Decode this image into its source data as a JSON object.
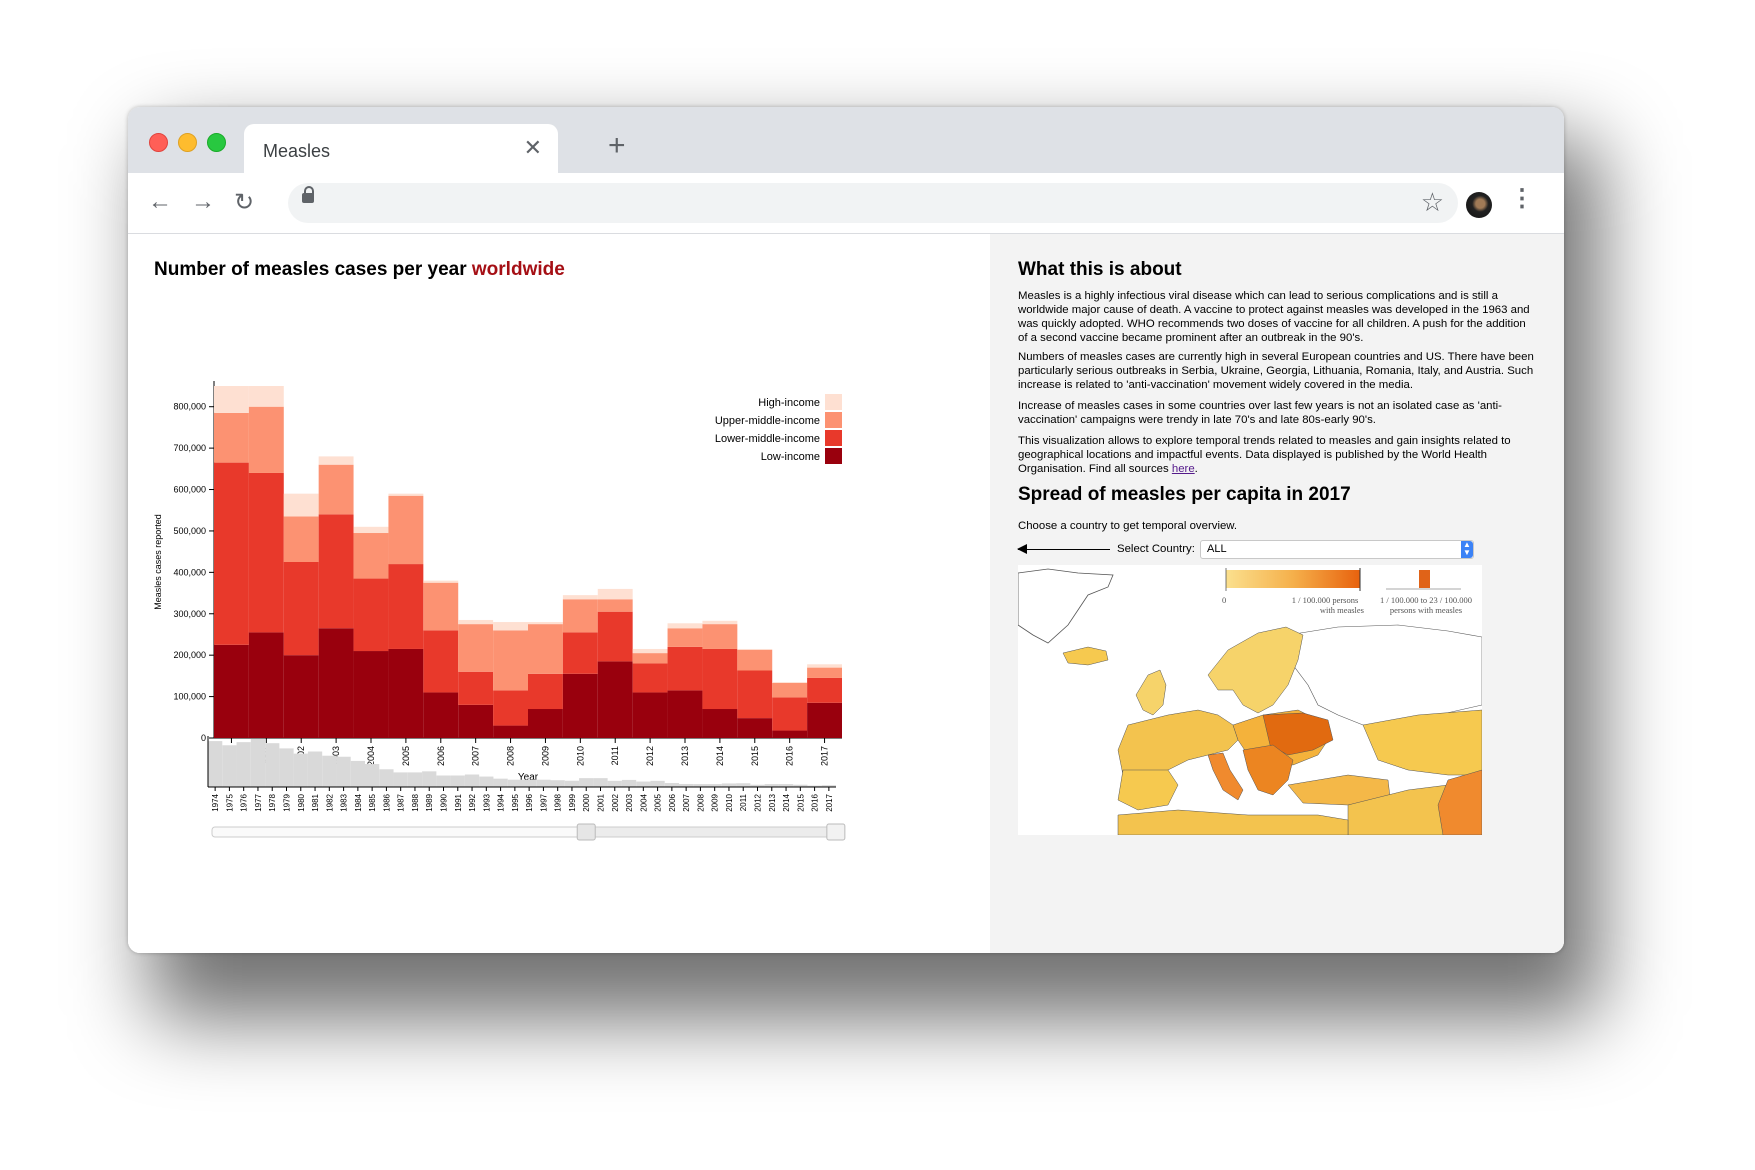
{
  "browser": {
    "tab_title": "Measles",
    "tab_close": "✕",
    "new_tab": "+"
  },
  "left": {
    "title_main": "Number of measles cases per year ",
    "title_highlight": "worldwide",
    "title_highlight_color": "#a50f15"
  },
  "right": {
    "about_title": "What this is about",
    "p1": "Measles is a highly infectious viral disease which can lead to serious complications and is still a worldwide major cause of death. A vaccine to protect against measles was developed in the 1963 and was quickly adopted. WHO recommends two doses of vaccine for all children. A push for the addition of a second vaccine became prominent after an outbreak in the 90's.",
    "p2": "Numbers of measles cases are currently high in several European countries and US. There have been particularly serious outbreaks in Serbia, Ukraine, Georgia, Lithuania, Romania, Italy, and Austria. Such increase is related to 'anti-vaccination' movement widely covered in the media.",
    "p3": "Increase of measles cases in some countries over last few years is not an isolated case as 'anti-vaccination' campaigns were trendy in late 70's and late 80s-early 90's.",
    "p4_text": "This visualization allows to explore temporal trends related to measles and gain insights related to geographical locations and impactful events. Data displayed is published by the World Health Organisation. Find all sources ",
    "p4_link": "here",
    "p4_end": ".",
    "spread_title": "Spread of measles per capita in 2017",
    "choose_text": "Choose a country to get temporal overview.",
    "select_label": "Select Country:",
    "select_value": "ALL",
    "map_legend": {
      "zero": "0",
      "label1_line1": "1 / 100.000 persons",
      "label1_line2": "with measles",
      "label2_line1": "1 / 100.000  to 23 / 100.000",
      "label2_line2": "persons with measles"
    }
  },
  "chart_data": [
    {
      "type": "bar",
      "stacked": true,
      "title": "Number of measles cases per year worldwide",
      "xlabel": "Year",
      "ylabel": "Measles cases reported",
      "ylim": [
        0,
        850000
      ],
      "yticks": [
        0,
        100000,
        200000,
        300000,
        400000,
        500000,
        600000,
        700000,
        800000
      ],
      "ytick_labels": [
        "0",
        "100,000",
        "200,000",
        "300,000",
        "400,000",
        "500,000",
        "600,000",
        "700,000",
        "800,000"
      ],
      "legend_position": "top-right",
      "categories": [
        "2000",
        "2001",
        "2002",
        "2003",
        "2004",
        "2005",
        "2006",
        "2007",
        "2008",
        "2009",
        "2010",
        "2011",
        "2012",
        "2013",
        "2014",
        "2015",
        "2016",
        "2017"
      ],
      "series": [
        {
          "name": "Low-income",
          "color": "#99000d",
          "values": [
            225000,
            255000,
            200000,
            265000,
            210000,
            215000,
            110000,
            80000,
            30000,
            70000,
            155000,
            185000,
            110000,
            115000,
            70000,
            48000,
            18000,
            85000
          ]
        },
        {
          "name": "Lower-middle-income",
          "color": "#e8392b",
          "values": [
            440000,
            385000,
            225000,
            275000,
            175000,
            205000,
            150000,
            80000,
            85000,
            85000,
            100000,
            120000,
            70000,
            105000,
            145000,
            115000,
            80000,
            60000
          ]
        },
        {
          "name": "Upper-middle-income",
          "color": "#fc9272",
          "values": [
            120000,
            160000,
            110000,
            120000,
            110000,
            165000,
            115000,
            115000,
            145000,
            120000,
            80000,
            30000,
            25000,
            45000,
            60000,
            50000,
            35000,
            25000
          ]
        },
        {
          "name": "High-income",
          "color": "#fee0d2",
          "values": [
            65000,
            50000,
            55000,
            20000,
            15000,
            5000,
            5000,
            10000,
            20000,
            5000,
            10000,
            25000,
            10000,
            12000,
            8000,
            2000,
            2000,
            8000
          ]
        }
      ]
    },
    {
      "type": "bar",
      "title": "",
      "color": "#d9d9d9",
      "brush_selection": [
        "2000",
        "2017"
      ],
      "categories": [
        "1974",
        "1975",
        "1976",
        "1977",
        "1978",
        "1979",
        "1980",
        "1981",
        "1982",
        "1983",
        "1984",
        "1985",
        "1986",
        "1987",
        "1988",
        "1989",
        "1990",
        "1991",
        "1992",
        "1993",
        "1994",
        "1995",
        "1996",
        "1997",
        "1998",
        "1999",
        "2000",
        "2001",
        "2002",
        "2003",
        "2004",
        "2005",
        "2006",
        "2007",
        "2008",
        "2009",
        "2010",
        "2011",
        "2012",
        "2013",
        "2014",
        "2015",
        "2016",
        "2017"
      ],
      "values": [
        4400000,
        4000000,
        4300000,
        4600000,
        4200000,
        3700000,
        3200000,
        3400000,
        3000000,
        2900000,
        2500000,
        2200000,
        1700000,
        1400000,
        1400000,
        1500000,
        1100000,
        1100000,
        1200000,
        1000000,
        800000,
        700000,
        700000,
        700000,
        650000,
        600000,
        850000,
        850000,
        590000,
        680000,
        520000,
        590000,
        380000,
        290000,
        280000,
        280000,
        340000,
        360000,
        220000,
        280000,
        280000,
        220000,
        135000,
        175000
      ]
    }
  ]
}
